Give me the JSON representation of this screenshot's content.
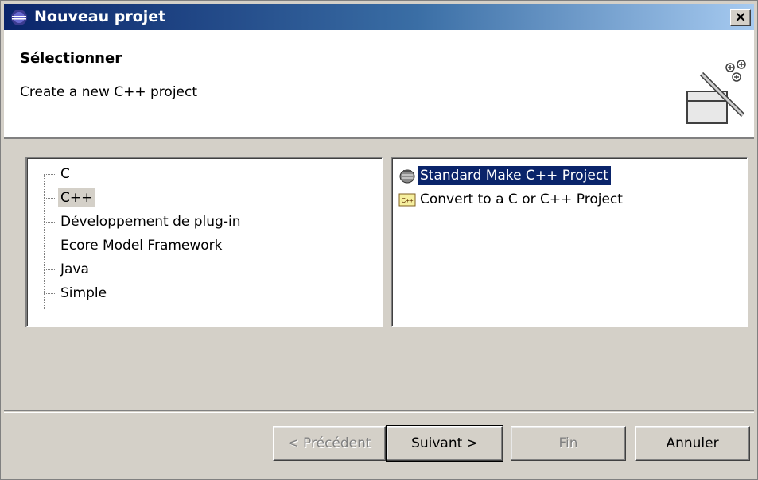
{
  "window": {
    "title": "Nouveau projet",
    "close_label": "×"
  },
  "header": {
    "title": "Sélectionner",
    "description": "Create a new C++ project",
    "icon": "new-project-wizard-icon"
  },
  "tree": {
    "items": [
      {
        "label": "C",
        "selected": false
      },
      {
        "label": "C++",
        "selected": true
      },
      {
        "label": "Développement de plug-in",
        "selected": false
      },
      {
        "label": "Ecore Model Framework",
        "selected": false
      },
      {
        "label": "Java",
        "selected": false
      },
      {
        "label": "Simple",
        "selected": false
      }
    ]
  },
  "wizards": {
    "items": [
      {
        "label": "Standard Make C++ Project",
        "icon": "make-project-icon",
        "selected": true
      },
      {
        "label": "Convert to a C or C++ Project",
        "icon": "cpp-convert-icon",
        "selected": false
      }
    ]
  },
  "buttons": {
    "previous": "< Précédent",
    "next": "Suivant >",
    "finish": "Fin",
    "cancel": "Annuler"
  },
  "colors": {
    "titlebar_start": "#0a246a",
    "titlebar_end": "#a6caf0",
    "selection": "#0a246a",
    "dialog_bg": "#d4d0c8"
  }
}
